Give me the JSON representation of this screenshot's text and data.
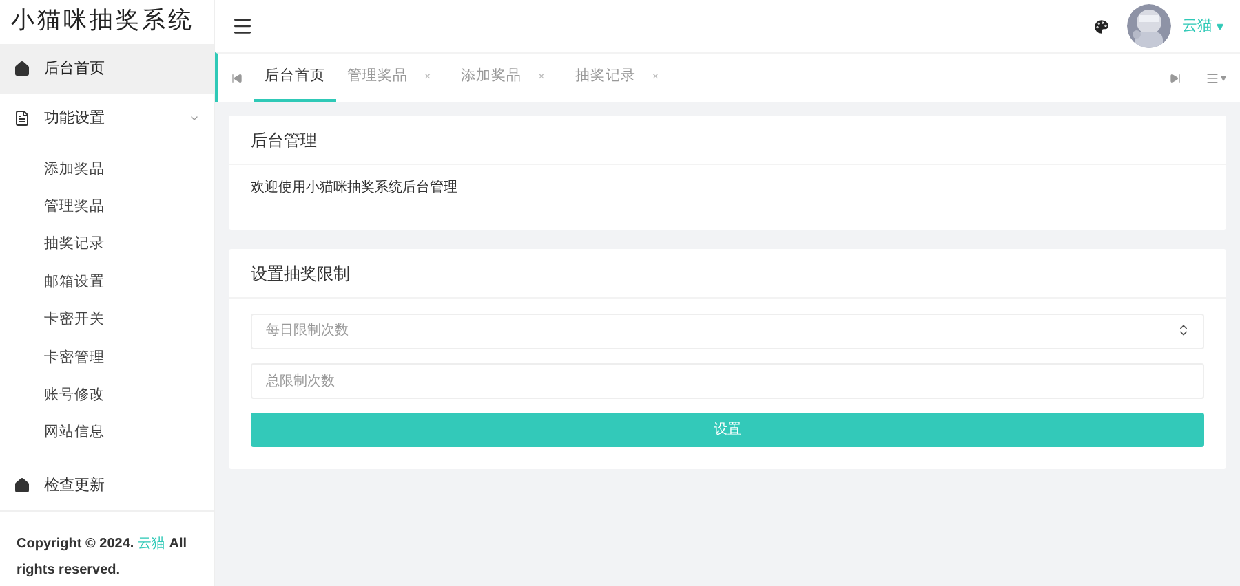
{
  "app_title": "小猫咪抽奖系统",
  "sidebar": {
    "items": [
      {
        "label": "后台首页",
        "kind": "home",
        "selected": true
      },
      {
        "label": "功能设置",
        "kind": "document",
        "selected": false,
        "expanded": true,
        "children": [
          {
            "label": "添加奖品",
            "selected": false
          },
          {
            "label": "管理奖品",
            "selected": false
          },
          {
            "label": "抽奖记录",
            "selected": false
          },
          {
            "label": "邮箱设置",
            "selected": false
          },
          {
            "label": "卡密开关",
            "selected": false
          },
          {
            "label": "卡密管理",
            "selected": false
          },
          {
            "label": "账号修改",
            "selected": false
          },
          {
            "label": "网站信息",
            "selected": false
          }
        ]
      },
      {
        "label": "检查更新",
        "kind": "home",
        "selected": false
      }
    ],
    "footer": {
      "before": "Copyright © 2024.",
      "link": "云猫",
      "after": "All rights reserved."
    }
  },
  "header": {
    "user": "云猫"
  },
  "tabs": [
    {
      "label": "后台首页",
      "selected": true,
      "closable": false
    },
    {
      "label": "管理奖品",
      "selected": false,
      "closable": true
    },
    {
      "label": "添加奖品",
      "selected": false,
      "closable": true
    },
    {
      "label": "抽奖记录",
      "selected": false,
      "closable": true
    }
  ],
  "close_glyph": "×",
  "welcome_card": {
    "title": "后台管理",
    "text": "欢迎使用小猫咪抽奖系统后台管理"
  },
  "settings_card": {
    "title": "设置抽奖限制",
    "fields": [
      {
        "placeholder": "每日限制次数",
        "kind": "number"
      },
      {
        "placeholder": "总限制次数",
        "kind": "text"
      }
    ],
    "button": "设置"
  }
}
